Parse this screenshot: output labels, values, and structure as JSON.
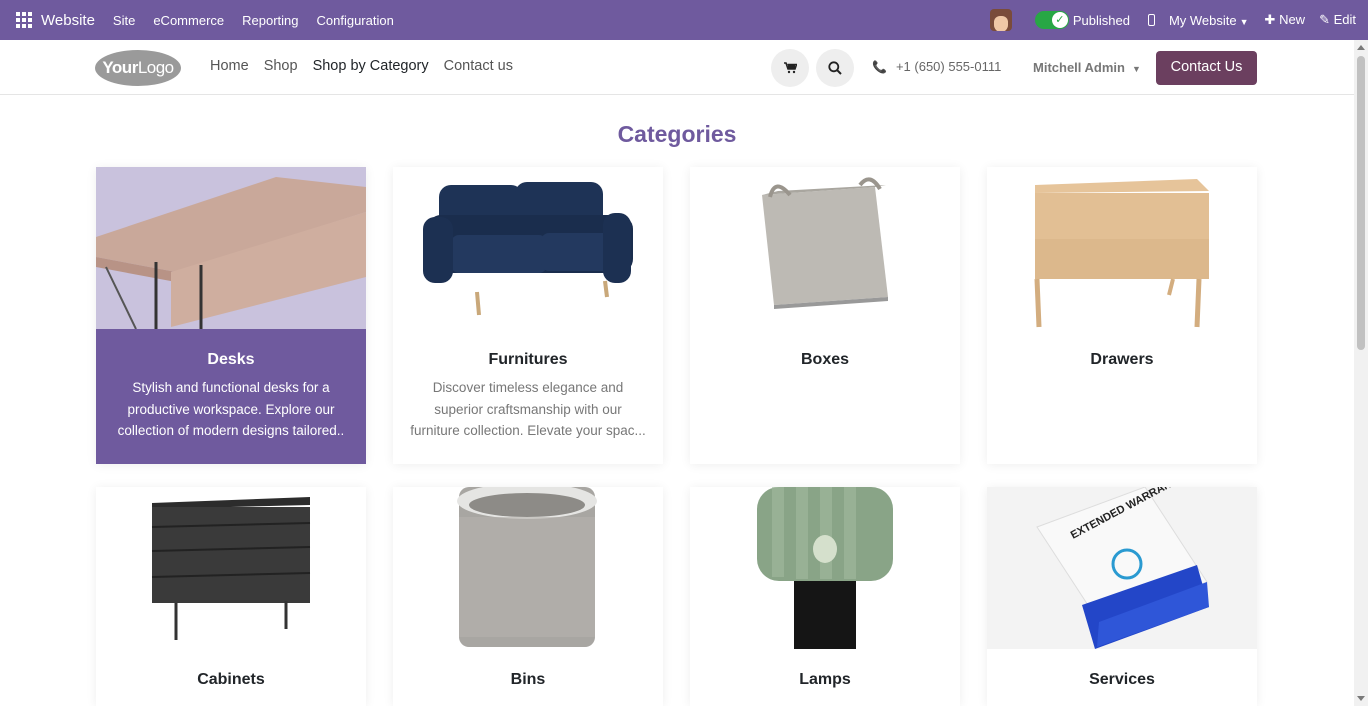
{
  "adminbar": {
    "brand": "Website",
    "menus": [
      "Site",
      "eCommerce",
      "Reporting",
      "Configuration"
    ],
    "published_label": "Published",
    "site_selector": "My Website",
    "new_label": "New",
    "edit_label": "Edit"
  },
  "header": {
    "logo_bold": "Your",
    "logo_light": "Logo",
    "nav": [
      "Home",
      "Shop",
      "Shop by Category",
      "Contact us"
    ],
    "active_nav": "Shop by Category",
    "phone": "+1 (650) 555-0111",
    "user": "Mitchell Admin",
    "contact_button": "Contact Us"
  },
  "page": {
    "heading": "Categories"
  },
  "categories": [
    {
      "title": "Desks",
      "desc": "Stylish and functional desks for a productive workspace. Explore our collection of modern designs tailored..",
      "featured": true,
      "icon": "desk-image"
    },
    {
      "title": "Furnitures",
      "desc": "Discover timeless elegance and superior craftsmanship with our furniture collection. Elevate your spac...",
      "featured": false,
      "icon": "sofa-image"
    },
    {
      "title": "Boxes",
      "desc": "",
      "featured": false,
      "icon": "basket-image"
    },
    {
      "title": "Drawers",
      "desc": "",
      "featured": false,
      "icon": "drawer-image"
    },
    {
      "title": "Cabinets",
      "desc": "",
      "featured": false,
      "icon": "cabinet-image"
    },
    {
      "title": "Bins",
      "desc": "",
      "featured": false,
      "icon": "bin-image"
    },
    {
      "title": "Lamps",
      "desc": "",
      "featured": false,
      "icon": "lamp-image"
    },
    {
      "title": "Services",
      "desc": "",
      "featured": false,
      "icon": "warranty-box-image"
    }
  ],
  "warranty_box_text": "EXTENDED WARRANTY",
  "colors": {
    "brand_purple": "#6f5a9e",
    "contact_button": "#6b3f5f",
    "published_green": "#28a745"
  }
}
